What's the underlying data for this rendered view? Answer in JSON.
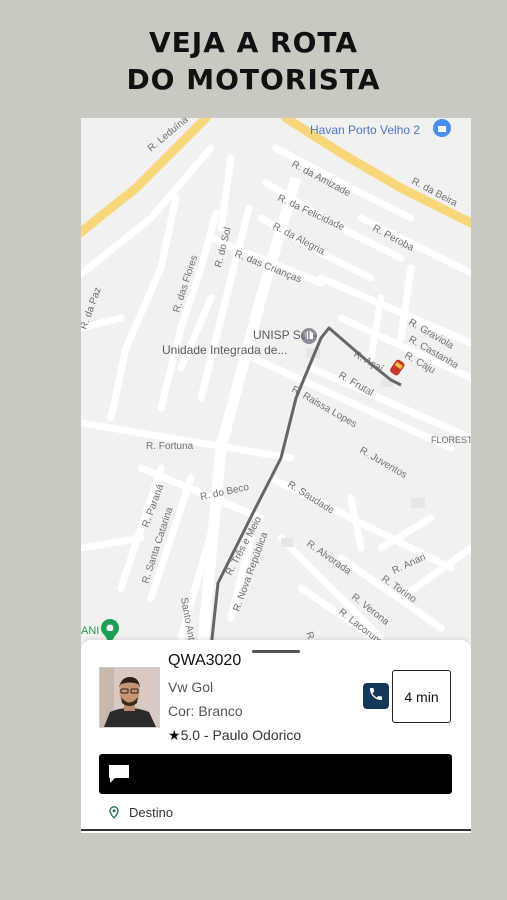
{
  "headline": {
    "line1": "VEJA A ROTA",
    "line2": "DO MOTORISTA"
  },
  "map": {
    "streets": [
      "R. Leduína",
      "Havan Porto Velho 2",
      "R. da Amizade",
      "R. da Felicidade",
      "R. da Alegria",
      "R. Peroba",
      "R. da Beira",
      "R. das Flores",
      "R. do Sol",
      "R. das Crianças",
      "R. da Paz",
      "UNISP Sul -",
      "Unidade Integrada de...",
      "R. Graviola",
      "R. Castanha",
      "R. Caju",
      "R. Açaí",
      "R. Frutal",
      "R. Raissa Lopes",
      "FLORESTA",
      "R. Fortuna",
      "R. Juventos",
      "R. Saudade",
      "R. Paraná",
      "R. do Beco",
      "R. Santa Catarina",
      "R. Três e Meio",
      "R. Nova República",
      "R. Alvorada",
      "R. Anari",
      "R. Torino",
      "R. Verona",
      "R. Lacorum",
      "R. Laguna",
      "Santo Antônio",
      "ANI"
    ]
  },
  "driver": {
    "plate": "QWA3020",
    "model": "Vw Gol",
    "color": "Cor: Branco",
    "star": "★",
    "rating": "5.0 - Paulo Odorico"
  },
  "eta": "4 min",
  "destination": "Destino",
  "icons": [
    "phone-icon",
    "chat-icon",
    "location-pin-icon",
    "map-pin-icon",
    "car-icon",
    "university-icon",
    "shopping-icon"
  ],
  "colors": {
    "call_button": "#14395b",
    "route": "#666666",
    "major_road": "#f7d77a"
  }
}
